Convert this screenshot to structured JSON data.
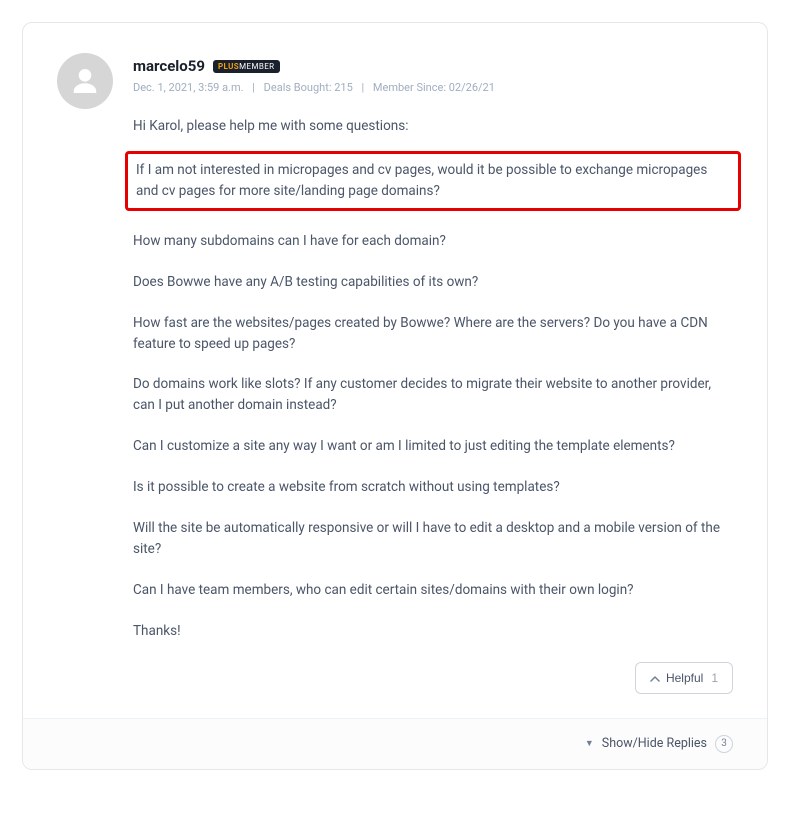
{
  "comment": {
    "username": "marcelo59",
    "badge_plus": "PLUS",
    "badge_member": "MEMBER",
    "meta": {
      "date": "Dec. 1, 2021, 3:59 a.m.",
      "deals": "Deals Bought: 215",
      "since": "Member Since: 02/26/21"
    },
    "paragraphs": {
      "p0": "Hi Karol, please help me with some questions:",
      "p1": "If I am not interested in micropages and cv pages, would it be possible to exchange micropages and cv pages for more site/landing page domains?",
      "p2": "How many subdomains can I have for each domain?",
      "p3": "Does Bowwe have any A/B testing capabilities of its own?",
      "p4": "How fast are the websites/pages created by Bowwe? Where are the servers? Do you have a CDN feature to speed up pages?",
      "p5": "Do domains work like slots? If any customer decides to migrate their website to another provider, can I put another domain instead?",
      "p6": "Can I customize a site any way I want or am I limited to just editing the template elements?",
      "p7": "Is it possible to create a website from scratch without using templates?",
      "p8": "Will the site be automatically responsive or will I have to edit a desktop and a mobile version of the site?",
      "p9": "Can I have team members, who can edit certain sites/domains with their own login?",
      "p10": "Thanks!"
    },
    "helpful_label": "Helpful",
    "helpful_count": "1"
  },
  "footer": {
    "toggle_label": "Show/Hide Replies",
    "reply_count": "3"
  }
}
